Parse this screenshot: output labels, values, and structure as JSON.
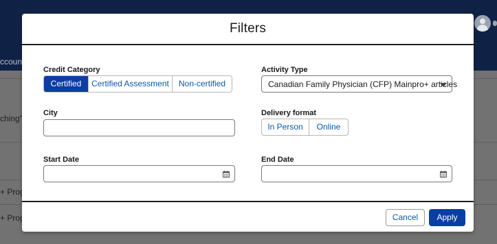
{
  "background": {
    "nav_fragment": "ccount",
    "search_fragment": "ching\" o",
    "row_fragment_1": "+ Progr",
    "row_fragment_2": "+ Progr"
  },
  "modal": {
    "title": "Filters",
    "credit_category": {
      "label": "Credit Category",
      "options": [
        "Certified",
        "Certified Assessment",
        "Non-certified"
      ],
      "selected": "Certified"
    },
    "activity_type": {
      "label": "Activity Type",
      "value": "Canadian Family Physician (CFP) Mainpro+ articles"
    },
    "city": {
      "label": "City",
      "value": ""
    },
    "delivery_format": {
      "label": "Delivery format",
      "options": [
        "In Person",
        "Online"
      ]
    },
    "start_date": {
      "label": "Start Date",
      "value": ""
    },
    "end_date": {
      "label": "End Date",
      "value": ""
    },
    "buttons": {
      "cancel": "Cancel",
      "apply": "Apply"
    }
  },
  "colors": {
    "brand_blue": "#0b3ea3",
    "link_blue": "#0b57a7",
    "header_navy": "#0f2246"
  }
}
